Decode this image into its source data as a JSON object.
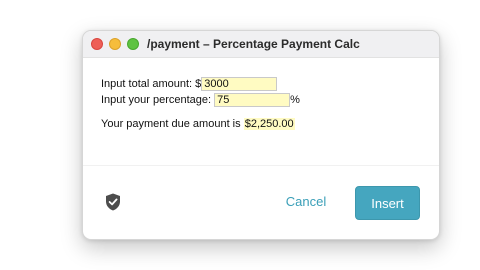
{
  "window": {
    "title": "/payment – Percentage Payment Calc"
  },
  "form": {
    "total_label": "Input total amount: $",
    "total_value": "3000",
    "percentage_label": "Input your percentage:",
    "percentage_value": "75",
    "percentage_suffix": "%"
  },
  "result": {
    "label": "Your payment due amount is",
    "amount": "$2,250.00"
  },
  "footer": {
    "cancel_label": "Cancel",
    "insert_label": "Insert"
  },
  "colors": {
    "accent": "#45a6bf",
    "field_highlight": "#fffbc2",
    "close": "#ee5f57",
    "minimize": "#f6bd3b",
    "zoom": "#5ec341"
  }
}
